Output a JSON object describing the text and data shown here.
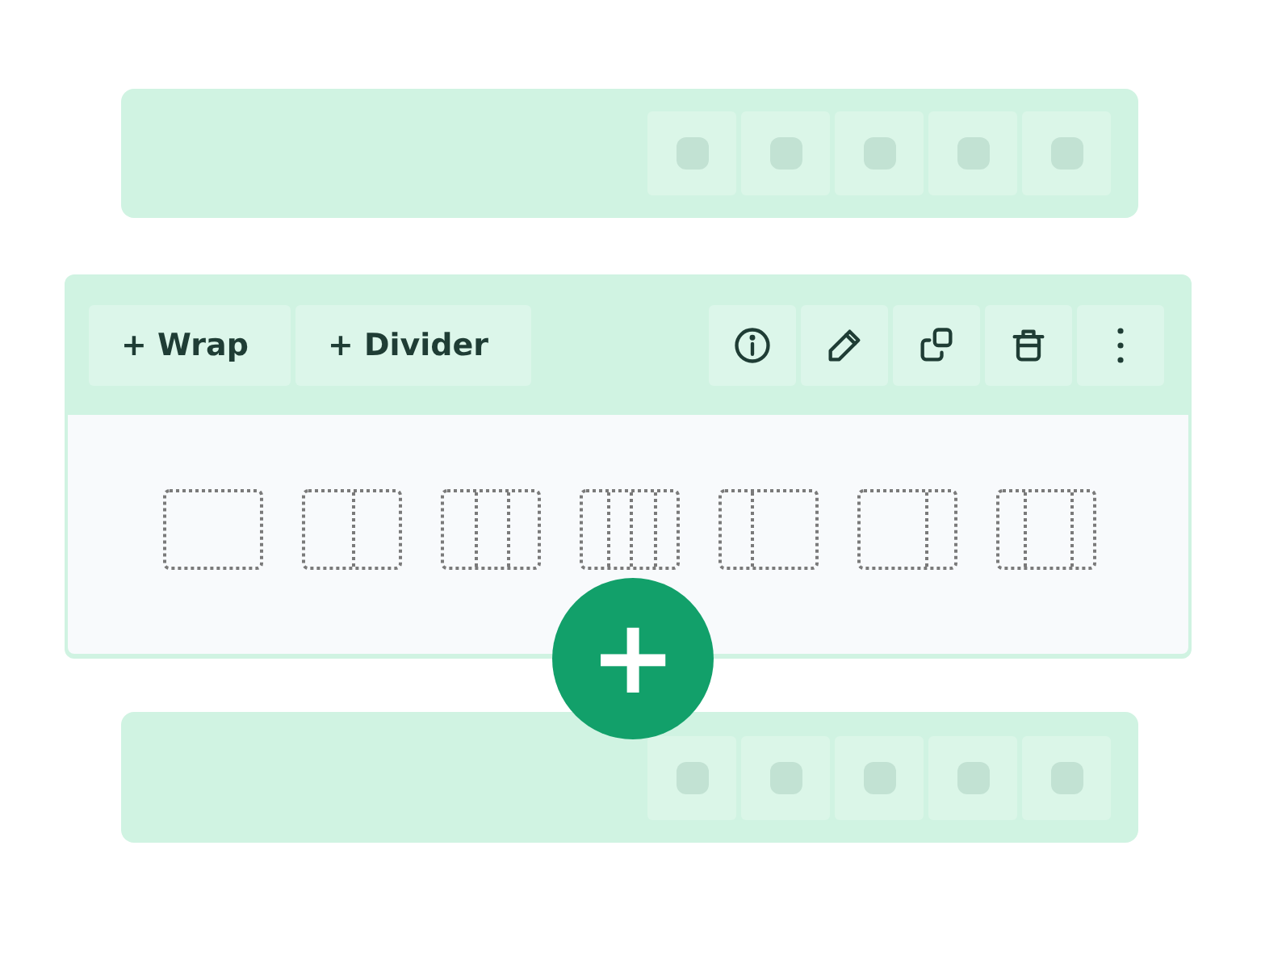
{
  "rows": [
    {
      "kind": "placeholder"
    },
    {
      "kind": "section",
      "actions": [
        {
          "label": "+ Wrap"
        },
        {
          "label": "+ Divider"
        }
      ],
      "tools": [
        {
          "kind": "info"
        },
        {
          "kind": "edit"
        },
        {
          "kind": "copy"
        },
        {
          "kind": "delete"
        },
        {
          "kind": "more"
        }
      ],
      "layouts": [
        {
          "kind": "single"
        },
        {
          "kind": "halves"
        },
        {
          "kind": "thirds"
        },
        {
          "kind": "quarters"
        },
        {
          "kind": "left-narrow"
        },
        {
          "kind": "right-narrow"
        },
        {
          "kind": "center-wide"
        }
      ],
      "add_button": {
        "label": "+"
      }
    },
    {
      "kind": "placeholder"
    }
  ]
}
